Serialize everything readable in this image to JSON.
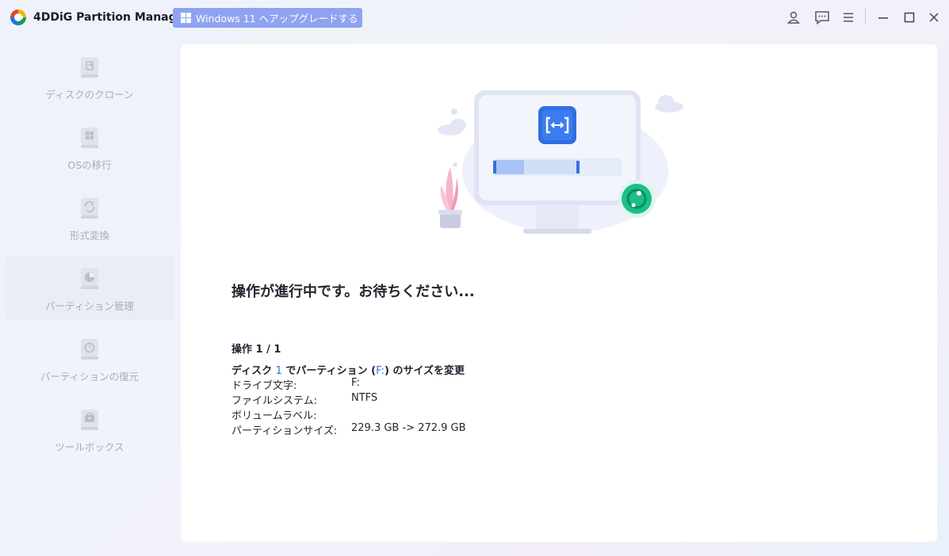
{
  "app": {
    "title": "4DDiG Partition Manager",
    "upgrade_label": "Windows 11 へアップグレードする",
    "accent_color": "#8fa3f0"
  },
  "titlebar_icons": [
    "user-icon",
    "feedback-icon",
    "menu-icon",
    "minimize-icon",
    "maximize-icon",
    "close-icon"
  ],
  "sidebar": {
    "items": [
      {
        "label": "ディスクのクローン",
        "icon": "disk-clone-icon"
      },
      {
        "label": "OSの移行",
        "icon": "os-migrate-icon"
      },
      {
        "label": "形式変換",
        "icon": "format-convert-icon"
      },
      {
        "label": "パーティション管理",
        "icon": "partition-manage-icon",
        "active": true
      },
      {
        "label": "パーティションの復元",
        "icon": "partition-restore-icon"
      },
      {
        "label": "ツールボックス",
        "icon": "toolbox-icon"
      }
    ]
  },
  "main": {
    "progress_title": "操作が進行中です。お待ちください...",
    "op_count": "操作 1 / 1",
    "op_desc": {
      "prefix": "ディスク ",
      "disk": "1",
      "middle": " でパーティション (",
      "partition": "F:",
      "suffix": ") のサイズを変更"
    },
    "details": [
      {
        "key": "ドライブ文字:",
        "value": "F:"
      },
      {
        "key": "ファイルシステム:",
        "value": "NTFS"
      },
      {
        "key": "ボリュームラベル:",
        "value": ""
      },
      {
        "key": "パーティションサイズ:",
        "value": "229.3 GB -> 272.9 GB"
      }
    ]
  }
}
